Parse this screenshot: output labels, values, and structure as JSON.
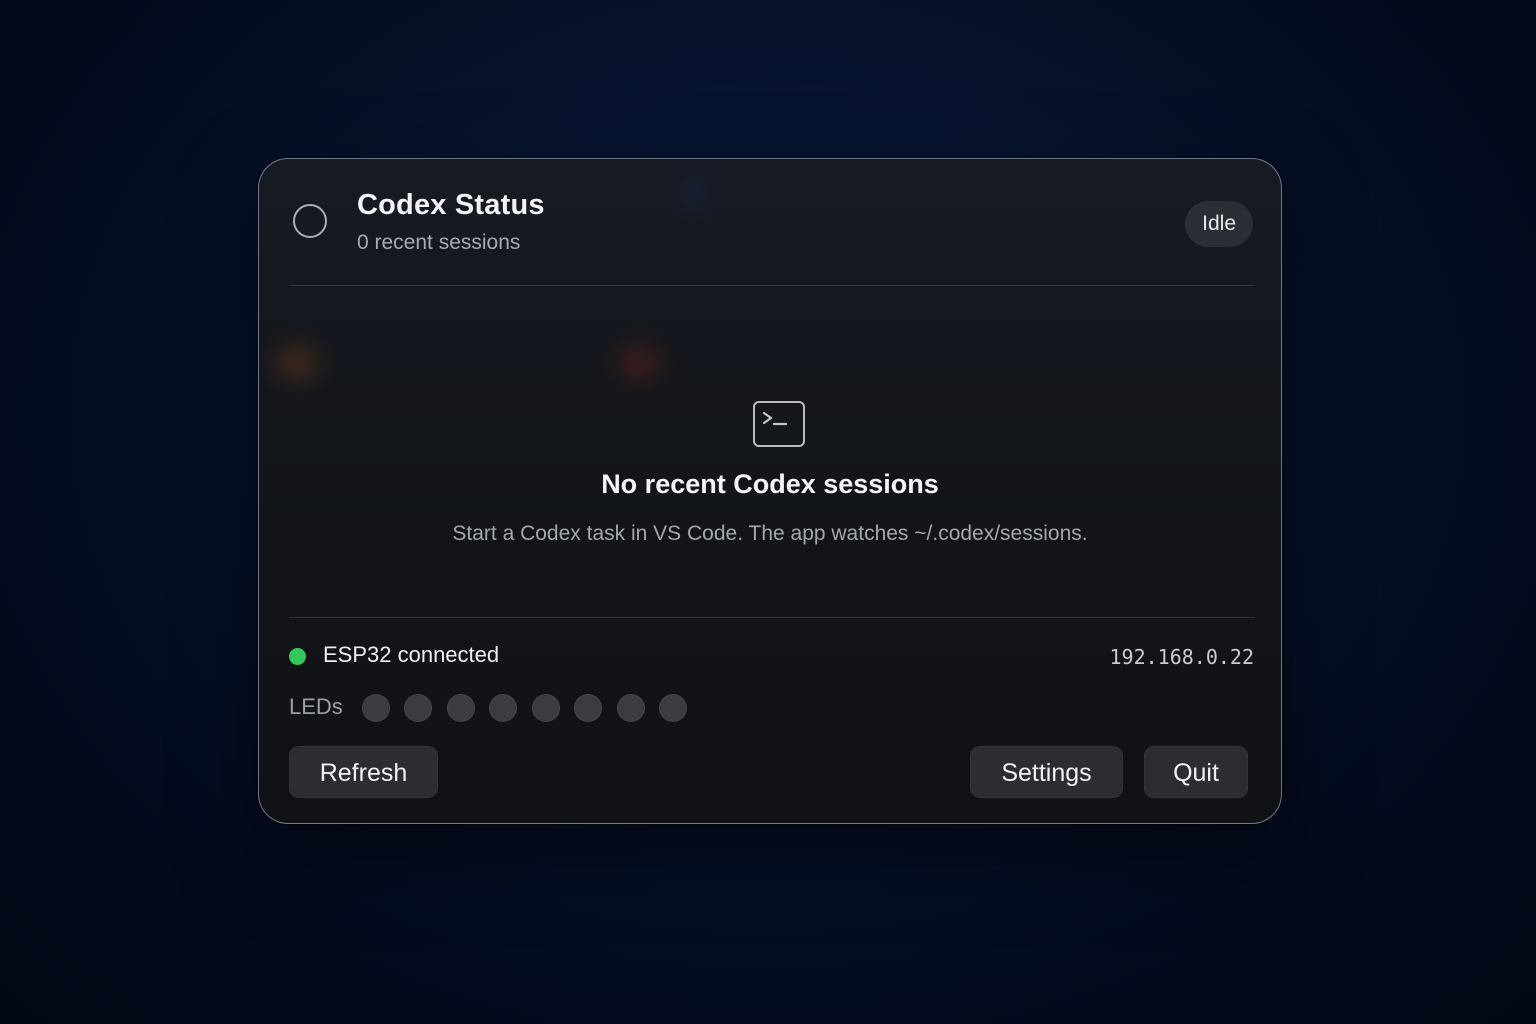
{
  "header": {
    "title": "Codex Status",
    "subtitle": "0 recent sessions",
    "status_badge": "Idle"
  },
  "empty_state": {
    "icon": "terminal-icon",
    "title": "No recent Codex sessions",
    "description": "Start a Codex task in VS Code. The app watches ~/.codex/sessions."
  },
  "device": {
    "status_label": "ESP32 connected",
    "status_color": "#34c759",
    "ip": "192.168.0.22"
  },
  "leds": {
    "label": "LEDs",
    "count": 8,
    "off_color": "#3a3c41"
  },
  "buttons": {
    "refresh": "Refresh",
    "settings": "Settings",
    "quit": "Quit"
  },
  "colors": {
    "panel_bg": "#14171d",
    "accent_border": "#bfcde1",
    "badge_bg": "#2b2e34",
    "button_bg": "#2b2d32"
  }
}
